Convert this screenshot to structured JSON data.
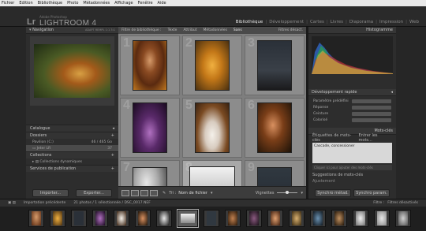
{
  "os_menu": [
    "Fichier",
    "Edition",
    "Bibliothèque",
    "Photo",
    "Métadonnées",
    "Affichage",
    "Fenêtre",
    "Aide"
  ],
  "app": {
    "logo": "Lr",
    "subtitle": "Adobe Photoshop",
    "name": "LIGHTROOM 4"
  },
  "modules": [
    "Bibliothèque",
    "Développement",
    "Cartes",
    "Livres",
    "Diaporama",
    "Impression",
    "Web"
  ],
  "left_panel": {
    "navigator": {
      "title": "Navigation",
      "zoom": [
        "ADAPT",
        "REMPL",
        "1:1",
        "3:1"
      ]
    },
    "catalog": "Catalogue",
    "folders": {
      "title": "Dossiers",
      "volume": "Pavilion (C:)",
      "volume_size": "46 / 465 Go",
      "folder": "Jeter LR",
      "folder_count": "37"
    },
    "collections": {
      "title": "Collections",
      "item": "Collections dynamiques"
    },
    "publish": "Services de publication",
    "import_label": "Importer...",
    "export_label": "Exporter..."
  },
  "filter_bar": {
    "title": "Filtre de bibliothèque :",
    "items": [
      "Texte",
      "Attribut",
      "Métadonnées",
      "Sans"
    ],
    "active": "Sans",
    "right": "Filtres désact."
  },
  "grid": {
    "numbers": [
      "1",
      "2",
      "3",
      "4",
      "5",
      "6",
      "7",
      "8",
      "9"
    ]
  },
  "toolbar": {
    "sort_label": "Tri :",
    "sort_value": "Nom de fichier",
    "thumb_label": "Vignettes"
  },
  "right_panel": {
    "histogram": "Histogramme",
    "quick_develop": "Développement rapide",
    "keywording": "Mots-clés",
    "kw_labels": {
      "tags": "Étiquettes de mots-clés",
      "enter": "Entrer les mots...",
      "input_hint": "Cliquer ici pour ajouter des mots-clés"
    },
    "keywords": "Cascade, concessioner",
    "suggestions": "Suggestions de mots-clés",
    "ajust": "Ajustement",
    "sync_meta": "Synchro métad.",
    "sync_settings": "Synchro param.",
    "qd_rows": [
      "Paramètre prédéfini",
      "Réponse",
      "Ceinture",
      "Colorisé"
    ]
  },
  "filmstrip_bar": {
    "left": "Importation précédente",
    "mid": "21 photos / 1 sélectionnée / DSC_0017.NEF",
    "filter": "Filtre :",
    "filter_value": "Filtres désactivés"
  },
  "colors": {
    "accent": "#e8e8e8",
    "panel": "#2d2d2d",
    "grid_bg": "#7e7e7e"
  }
}
